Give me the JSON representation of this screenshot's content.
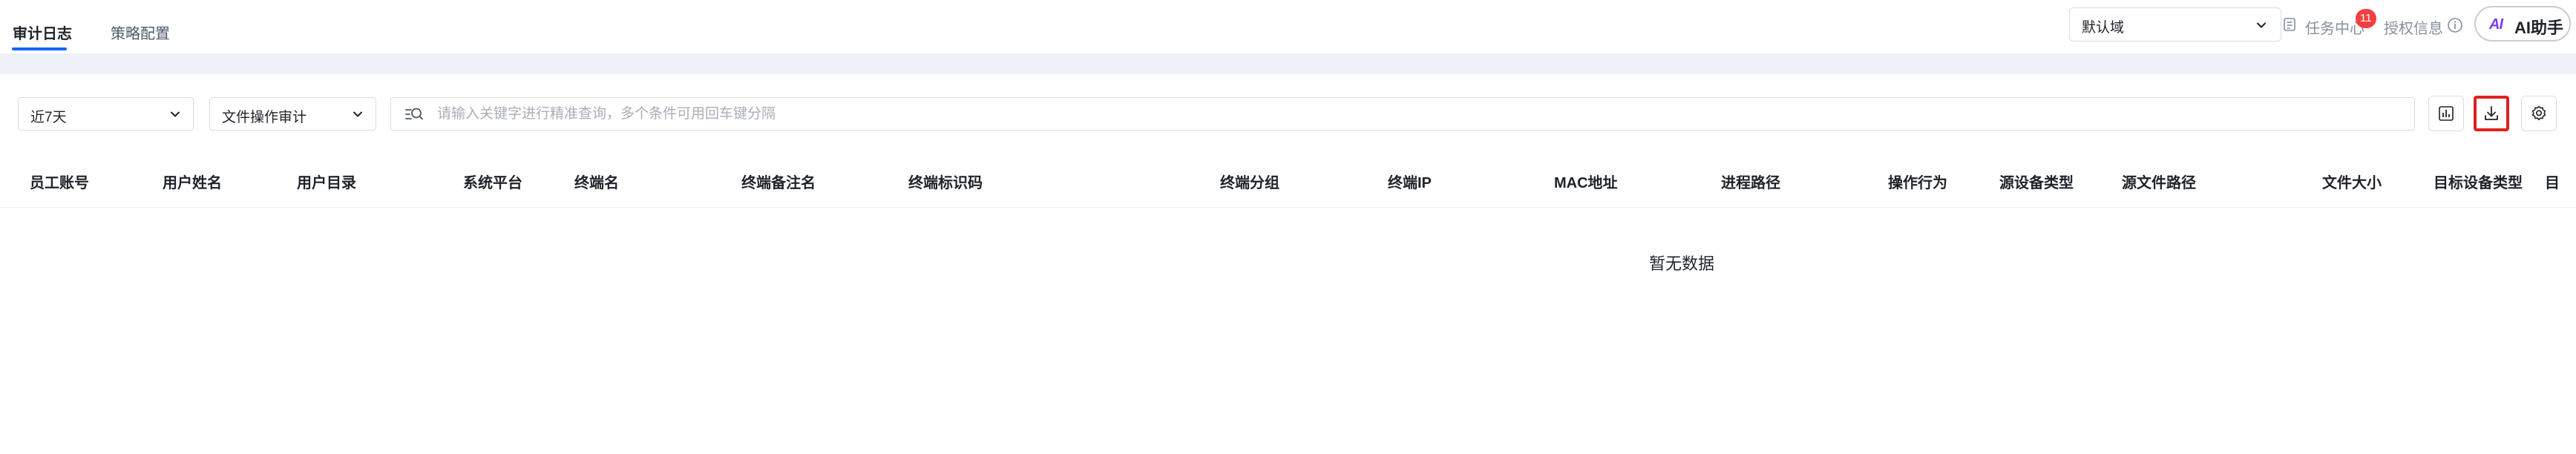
{
  "tabs": [
    {
      "label": "审计日志",
      "active": true
    },
    {
      "label": "策略配置",
      "active": false
    }
  ],
  "header": {
    "domain_select": {
      "value": "默认域"
    },
    "task_center": {
      "label": "任务中心",
      "badge": "11"
    },
    "license_label": "授权信息",
    "ai_assistant": {
      "logo": "AI",
      "label": "AI助手"
    }
  },
  "toolbar": {
    "time_range": {
      "value": "近7天"
    },
    "audit_type": {
      "value": "文件操作审计"
    },
    "search": {
      "placeholder": "请输入关键字进行精准查询，多个条件可用回车键分隔",
      "value": ""
    },
    "icons": [
      "chart-icon",
      "download-icon",
      "settings-icon"
    ]
  },
  "table": {
    "columns": [
      "员工账号",
      "用户姓名",
      "用户目录",
      "系统平台",
      "终端名",
      "终端备注名",
      "终端标识码",
      "终端分组",
      "终端IP",
      "MAC地址",
      "进程路径",
      "操作行为",
      "源设备类型",
      "源文件路径",
      "文件大小",
      "目标设备类型",
      "目"
    ],
    "empty_text": "暂无数据"
  },
  "colors": {
    "accent": "#1664ff",
    "badge": "#f53f3f",
    "highlight": "#e02020",
    "band": "#eef1f7"
  }
}
